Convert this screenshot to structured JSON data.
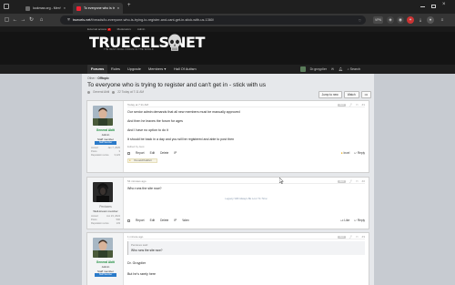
{
  "browser": {
    "tabs": [
      {
        "label": "lookmax.org - Men's Self I...",
        "close": "×"
      },
      {
        "label": "To everyone who is trying...",
        "close": "×"
      }
    ],
    "new_tab": "+",
    "nav": {
      "back": "←",
      "forward": "→",
      "reload": "↻"
    },
    "url_host": "truecels.net",
    "url_path": "/threads/to-everyone-who-is-trying-to-register-and-cant-get-in-stick-with-us.1360/",
    "vpn_label": "VPN"
  },
  "forum": {
    "top_strip": {
      "external_access": "External access",
      "moderators": "Moderators",
      "admin": "Admin",
      "badge": "2"
    },
    "logo": "TRUECELS.NET",
    "logo_sub": "THE BEST INCEL FORUM IN THE WORLD",
    "nav": {
      "items": [
        "Forums",
        "Rules",
        "Upgrade",
        "Members",
        "Hall Of Autism"
      ],
      "members_caret": "▾",
      "user": "Dr.groyplier",
      "search": "Search"
    }
  },
  "thread": {
    "breadcrumb": {
      "root": "Other",
      "sep": "›",
      "section": "Offtopic"
    },
    "title": "To everyone who is trying to register and can't get in - stick with us",
    "meta": {
      "author": "General Abiti",
      "date": "22 Today at 7:11 AM"
    },
    "pager": {
      "jump": "Jump to new",
      "watch": "Watch",
      "more": "•••"
    }
  },
  "posts": [
    {
      "user": {
        "name": "General Abiti",
        "role": "Admin",
        "title": "Staff member",
        "bar": "Staff Member",
        "stats": [
          {
            "k": "Joined",
            "v": "Jan 7, 2025"
          },
          {
            "k": "Posts",
            "v": "3"
          },
          {
            "k": "Reputation score",
            "v": "3,123"
          }
        ]
      },
      "head": {
        "date": "Today at 7:11 AM",
        "tag": "NEW",
        "num": "#1"
      },
      "lines": [
        "Our senior admin demands that all new members must be manually approved",
        "And then he leaves the forum for ages",
        "And I have no option to do it",
        "It should be back in a day and you will be registered and able to post then"
      ],
      "edited": "Edited by Aust",
      "foot": {
        "report": "Report",
        "edit": "Edit",
        "delete": "Delete",
        "ip": "IP",
        "react": "Incel",
        "reply": "Reply"
      },
      "reactions": "You and Kudzuri"
    },
    {
      "user": {
        "name": "Peniaxes",
        "role": "Well-known member",
        "bar": "",
        "stats": [
          {
            "k": "Joined",
            "v": "Jun 23, 2024"
          },
          {
            "k": "Posts",
            "v": "500"
          },
          {
            "k": "Reputation score",
            "v": "133"
          }
        ]
      },
      "head": {
        "date": "54 minutes ago",
        "tag": "NEW",
        "num": "#2"
      },
      "lines": [
        "Who runs the site now?"
      ],
      "signature": "Legacy Will Always Be Lost To Time",
      "foot": {
        "report": "Report",
        "edit": "Edit",
        "delete": "Delete",
        "ip": "IP",
        "warn": "Warn",
        "like": "Like",
        "reply": "Reply"
      }
    },
    {
      "user": {
        "name": "General Abiti",
        "role": "Admin",
        "title": "Staff member",
        "bar": "Staff Member"
      },
      "head": {
        "date": "1 minute ago",
        "tag": "NEW",
        "num": "#3"
      },
      "quote": {
        "by": "Peniaxes said:",
        "text": "Who runs the site now?"
      },
      "lines": [
        "Dr. Groyplier",
        "But he's rarely here"
      ]
    }
  ],
  "colors": {
    "staff_green": "#1e8e3e",
    "staff_bar": "#2a7ac9",
    "header_bg": "#141414"
  }
}
